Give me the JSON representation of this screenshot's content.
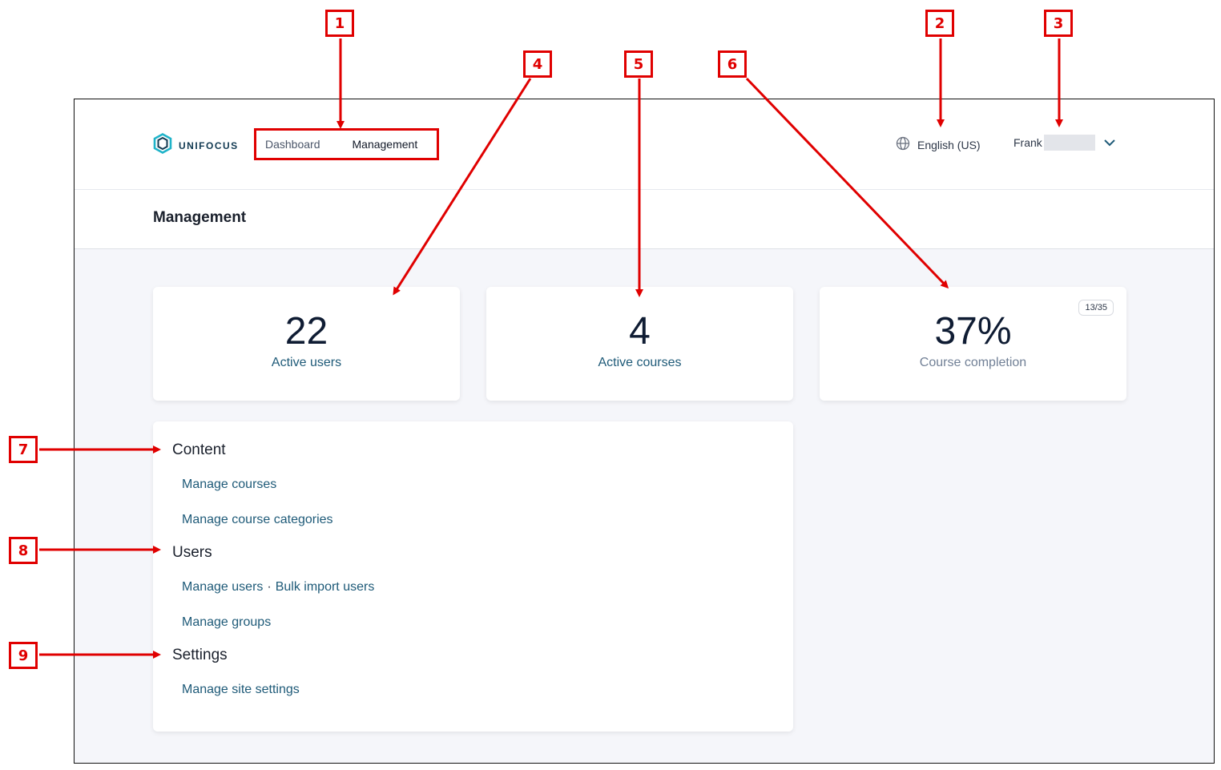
{
  "app": {
    "logo_text": "UNIFOCUS",
    "nav": [
      "Dashboard",
      "Management"
    ],
    "active_nav": "Management",
    "language": "English (US)",
    "user_name": "Frank"
  },
  "page": {
    "title": "Management"
  },
  "stats": [
    {
      "value": "22",
      "label": "Active users"
    },
    {
      "value": "4",
      "label": "Active courses"
    },
    {
      "value": "37%",
      "label": "Course completion",
      "badge": "13/35"
    }
  ],
  "sections": {
    "content": {
      "heading": "Content",
      "links": [
        "Manage courses",
        "Manage course categories"
      ]
    },
    "users": {
      "heading": "Users",
      "links": [
        "Manage users",
        "Bulk import users",
        "Manage groups"
      ],
      "separator": "·"
    },
    "settings": {
      "heading": "Settings",
      "links": [
        "Manage site settings"
      ]
    }
  },
  "annotations": [
    "1",
    "2",
    "3",
    "4",
    "5",
    "6",
    "7",
    "8",
    "9"
  ],
  "colors": {
    "annotation": "#e00000",
    "link": "#1e5a78",
    "background": "#f5f6fa"
  }
}
